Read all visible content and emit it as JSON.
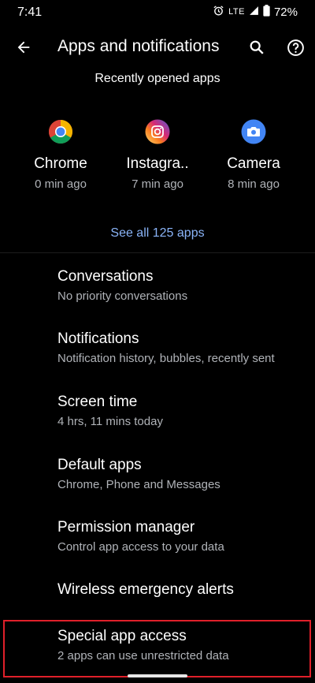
{
  "status_bar": {
    "time": "7:41",
    "network": "LTE",
    "battery": "72%"
  },
  "app_bar": {
    "title": "Apps and notifications"
  },
  "recent": {
    "header": "Recently opened apps",
    "apps": [
      {
        "name": "Chrome",
        "time": "0 min ago",
        "icon": "chrome-icon"
      },
      {
        "name": "Instagra..",
        "time": "7 min ago",
        "icon": "instagram-icon"
      },
      {
        "name": "Camera",
        "time": "8 min ago",
        "icon": "camera-icon"
      }
    ],
    "see_all": "See all 125 apps"
  },
  "settings": [
    {
      "title": "Conversations",
      "subtitle": "No priority conversations"
    },
    {
      "title": "Notifications",
      "subtitle": "Notification history, bubbles, recently sent"
    },
    {
      "title": "Screen time",
      "subtitle": "4 hrs, 11 mins today"
    },
    {
      "title": "Default apps",
      "subtitle": "Chrome, Phone and Messages"
    },
    {
      "title": "Permission manager",
      "subtitle": "Control app access to your data"
    },
    {
      "title": "Wireless emergency alerts",
      "subtitle": ""
    },
    {
      "title": "Special app access",
      "subtitle": "2 apps can use unrestricted data"
    }
  ],
  "colors": {
    "background": "#000000",
    "accent_link": "#8ab4f8",
    "highlight": "#e0202a"
  }
}
